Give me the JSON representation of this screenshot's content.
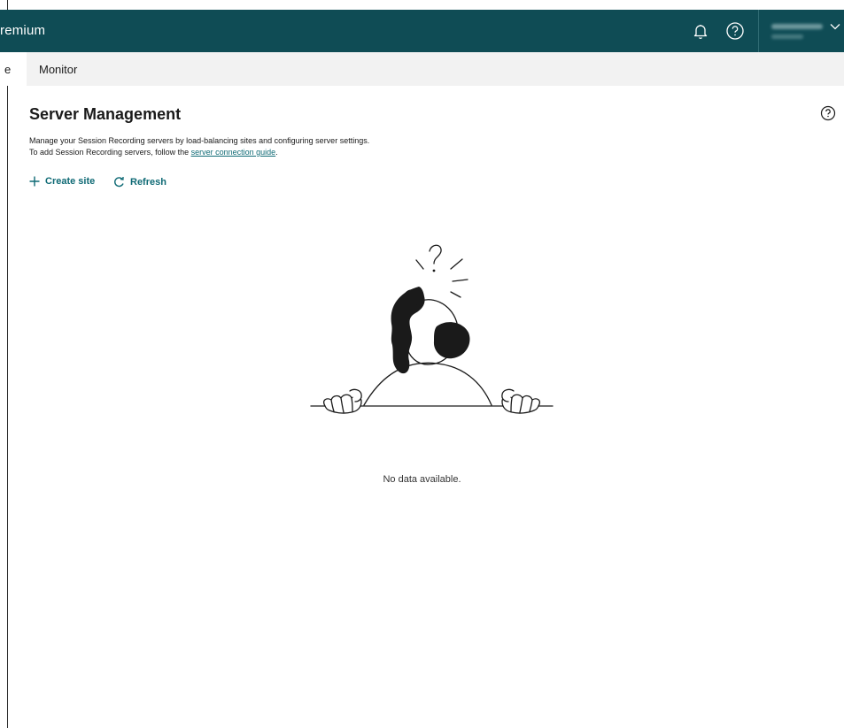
{
  "topbar": {
    "brand_text": "remium",
    "icons": [
      "bell-icon",
      "help-circle-icon",
      "chevron-down-icon"
    ]
  },
  "nav": {
    "partial_tab": "e",
    "tabs": [
      {
        "label": "Monitor"
      }
    ]
  },
  "page": {
    "title": "Server Management",
    "description_line1": "Manage your Session Recording servers by load-balancing sites and configuring server settings.",
    "description_line2_prefix": "To add Session Recording servers, follow the ",
    "description_link": "server connection guide",
    "description_line2_suffix": "."
  },
  "actions": {
    "create_label": "Create site",
    "refresh_label": "Refresh"
  },
  "empty_state": {
    "message": "No data available."
  },
  "colors": {
    "topbar_bg": "#0f4c55",
    "accent": "#0f6a75",
    "nav_bg": "#f2f2f2"
  }
}
